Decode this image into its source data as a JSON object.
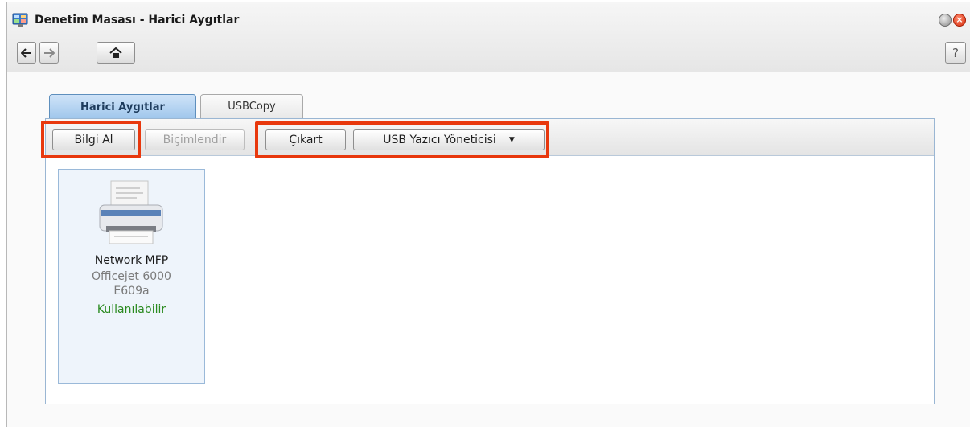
{
  "window": {
    "title": "Denetim Masası - Harici Aygıtlar",
    "app_icon": "control-panel-icon"
  },
  "nav": {
    "back_icon": "arrow-left-icon",
    "forward_icon": "arrow-right-icon",
    "home_icon": "home-icon",
    "help_label": "?"
  },
  "tabs": [
    {
      "label": "Harici Aygıtlar",
      "active": true
    },
    {
      "label": "USBCopy",
      "active": false
    }
  ],
  "toolbar": {
    "info_label": "Bilgi Al",
    "format_label": "Biçimlendir",
    "eject_label": "Çıkart",
    "usb_printer_label": "USB Yazıcı Yöneticisi"
  },
  "device": {
    "name": "Network MFP",
    "model_line1": "Officejet 6000",
    "model_line2": "E609a",
    "status": "Kullanılabilir",
    "icon": "printer-icon"
  },
  "colors": {
    "highlight": "#e8380d",
    "status_ok": "#2a8a1f",
    "tab_active": "#9fc6ec"
  }
}
